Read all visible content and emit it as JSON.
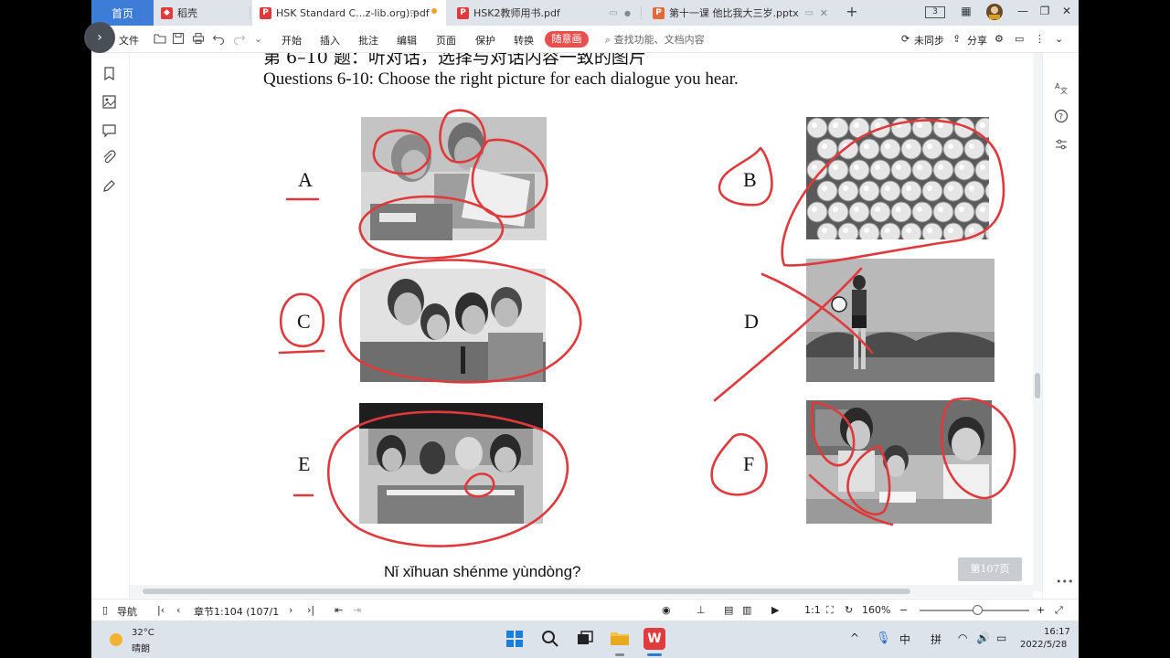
{
  "tabs": [
    {
      "label": "首页",
      "type": "home"
    },
    {
      "label": "稻壳",
      "icon": "docer-icon"
    },
    {
      "label": "HSK Standard C...z-lib.org).pdf",
      "icon": "pdf-icon",
      "active": true
    },
    {
      "label": "HSK2教师用书.pdf",
      "icon": "pdf-icon"
    },
    {
      "label": "第十一课 他比我大三岁.pptx",
      "icon": "pptx-icon"
    }
  ],
  "window": {
    "badge": "3"
  },
  "toolbar": {
    "file_label": "文件",
    "menu": [
      "开始",
      "插入",
      "批注",
      "编辑",
      "页面",
      "保护",
      "转换"
    ],
    "special": "随意画",
    "search_placeholder": "查找功能、文档内容",
    "sync": "未同步",
    "share": "分享"
  },
  "document": {
    "heading_cn": "第 6–10 题：听对话，选择与对话内容一致的图片",
    "heading_en": "Questions 6-10: Choose the right picture for each dialogue you hear.",
    "letters": [
      "A",
      "B",
      "C",
      "D",
      "E",
      "F"
    ],
    "pinyin": "Nǐ  xǐhuan shénme yùndòng?",
    "page_button": "第107页"
  },
  "statusbar": {
    "nav_label": "导航",
    "chapter": "章节1:104 (107/1",
    "zoom": "160%"
  },
  "taskbar": {
    "temp": "32°C",
    "weather": "晴朗",
    "ime_lang": "中",
    "ime_mode": "拼",
    "time": "16:17",
    "date": "2022/5/28"
  },
  "colors": {
    "accent": "#3d7dd8",
    "annotation": "#e0393c",
    "special": "#e84f4f"
  }
}
